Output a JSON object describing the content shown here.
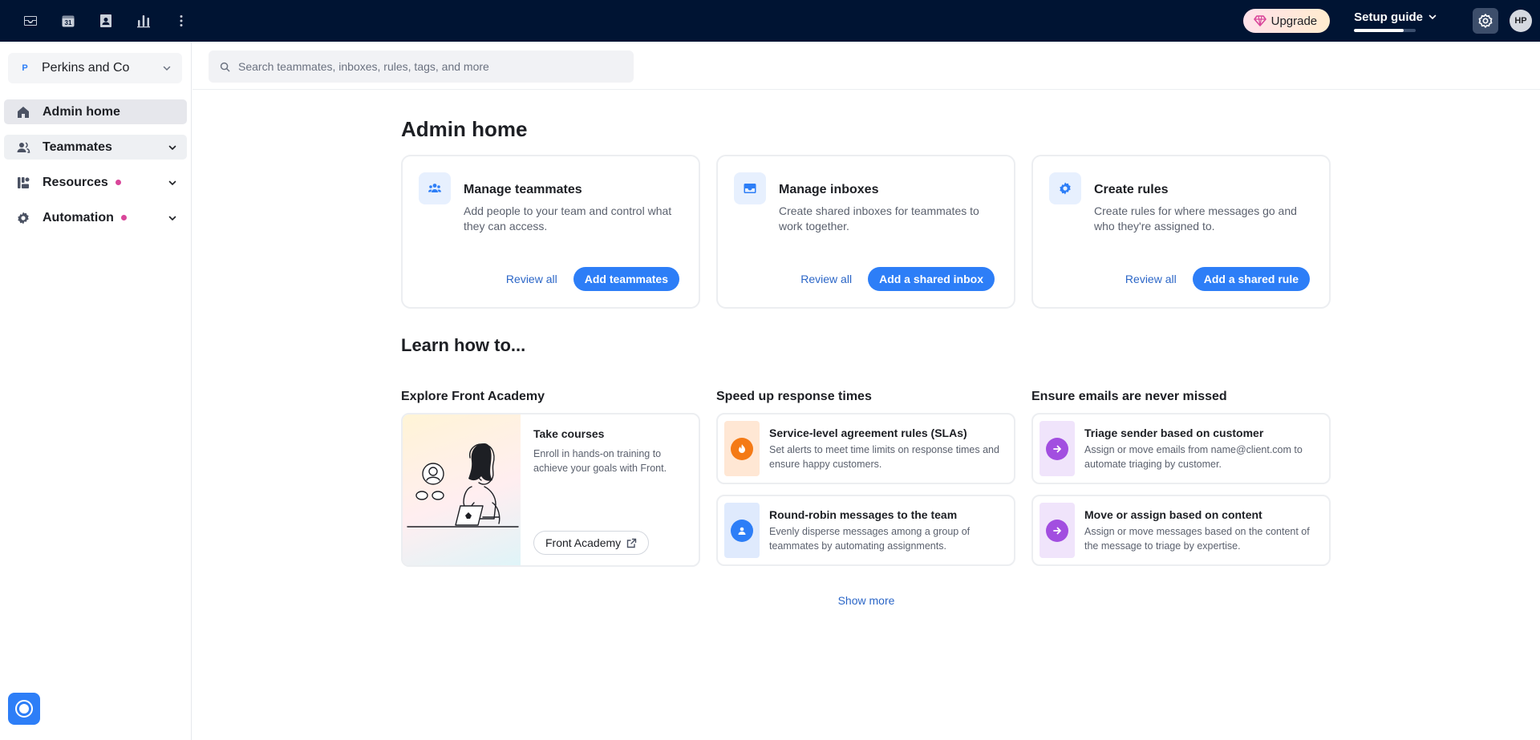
{
  "topbar": {
    "nav_icons": [
      "inbox-icon",
      "calendar-icon",
      "contacts-icon",
      "analytics-icon",
      "more-icon"
    ],
    "calendar_day": "31",
    "upgrade_label": "Upgrade",
    "setup_guide_label": "Setup guide",
    "setup_guide_progress": 0.8,
    "avatar_initials": "HP"
  },
  "sidebar": {
    "company": {
      "logo_letter": "P",
      "name": "Perkins and Co"
    },
    "items": [
      {
        "label": "Admin home",
        "icon": "home-icon",
        "active": true
      },
      {
        "label": "Teammates",
        "icon": "teammates-icon",
        "expandable": true
      },
      {
        "label": "Resources",
        "icon": "resources-icon",
        "expandable": true,
        "dot": true
      },
      {
        "label": "Automation",
        "icon": "gear-icon",
        "expandable": true,
        "dot": true
      }
    ],
    "dot_color": "#d9469a"
  },
  "search": {
    "placeholder": "Search teammates, inboxes, rules, tags, and more",
    "value": ""
  },
  "main": {
    "title": "Admin home",
    "cards": [
      {
        "title": "Manage teammates",
        "description": "Add people to your team and control what they can access.",
        "secondary": "Review all",
        "primary": "Add teammates",
        "icon": "teammates-icon"
      },
      {
        "title": "Manage inboxes",
        "description": "Create shared inboxes for teammates to work together.",
        "secondary": "Review all",
        "primary": "Add a shared inbox",
        "icon": "inbox-icon"
      },
      {
        "title": "Create rules",
        "description": "Create rules for where messages go and who they're assigned to.",
        "secondary": "Review all",
        "primary": "Add a shared rule",
        "icon": "rules-gear-icon"
      }
    ],
    "learn_title": "Learn how to...",
    "columns": [
      {
        "title": "Explore Front Academy",
        "academy": {
          "title": "Take courses",
          "description": "Enroll in hands-on training to achieve your goals with Front.",
          "button": "Front Academy"
        }
      },
      {
        "title": "Speed up response times",
        "tips": [
          {
            "title": "Service-level agreement rules (SLAs)",
            "description": "Set alerts to meet time limits on response times and ensure happy customers.",
            "icon": "timer-icon"
          },
          {
            "title": "Round-robin messages to the team",
            "description": "Evenly disperse messages among a group of teammates by automating assignments.",
            "icon": "user-assign-icon"
          }
        ]
      },
      {
        "title": "Ensure emails are never missed",
        "tips": [
          {
            "title": "Triage sender based on customer",
            "description": "Assign or move emails from name@client.com to automate triaging by customer.",
            "icon": "arrow-right-icon"
          },
          {
            "title": "Move or assign based on content",
            "description": "Assign or move messages based on the content of the message to triage by expertise.",
            "icon": "arrow-right-icon"
          }
        ]
      }
    ],
    "show_more": "Show more"
  },
  "colors": {
    "topbar_bg": "#001433",
    "accent": "#2d7ef7",
    "link": "#2b66c7",
    "orange": "#f47a16",
    "purple": "#a24ee0"
  }
}
